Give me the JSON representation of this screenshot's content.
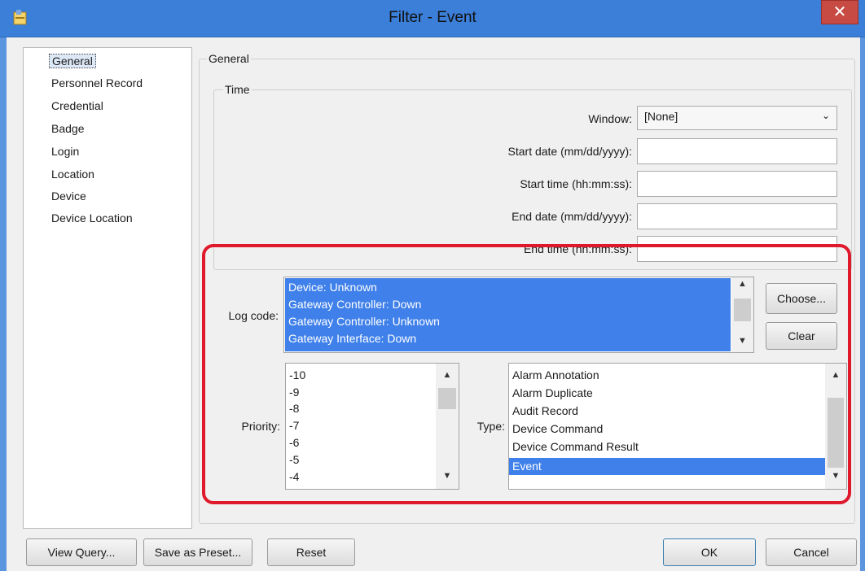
{
  "window": {
    "title": "Filter - Event",
    "close_glyph": "✕"
  },
  "nav": {
    "items": [
      "General",
      "Personnel Record",
      "Credential",
      "Badge",
      "Login",
      "Location",
      "Device",
      "Device Location"
    ],
    "selected_index": 0
  },
  "general": {
    "group_label": "General",
    "time_group_label": "Time",
    "window_label": "Window:",
    "window_value": "[None]",
    "start_date_label": "Start date (mm/dd/yyyy):",
    "start_time_label": "Start time (hh:mm:ss):",
    "end_date_label": "End date (mm/dd/yyyy):",
    "end_time_label": "End time (hh:mm:ss):",
    "start_date_value": "",
    "start_time_value": "",
    "end_date_value": "",
    "end_time_value": ""
  },
  "log_code": {
    "label": "Log code:",
    "items": [
      "Device: Unknown",
      "Gateway Controller: Down",
      "Gateway Controller: Unknown",
      "Gateway Interface: Down"
    ],
    "choose_label": "Choose...",
    "clear_label": "Clear"
  },
  "priority": {
    "label": "Priority:",
    "items": [
      "-10",
      "-9",
      "-8",
      "-7",
      "-6",
      "-5",
      "-4"
    ]
  },
  "type": {
    "label": "Type:",
    "items": [
      "Alarm Annotation",
      "Alarm Duplicate",
      "Audit Record",
      "Device Command",
      "Device Command Result",
      "Event"
    ],
    "selected": "Event"
  },
  "footer": {
    "view_query": "View Query...",
    "save_preset": "Save as Preset...",
    "reset": "Reset",
    "ok": "OK",
    "cancel": "Cancel"
  },
  "colors": {
    "titlebar": "#3b7fd9",
    "selection": "#3f80ea",
    "highlight_outline": "#e0182b",
    "close_button": "#c74b42"
  },
  "icons": [
    "app-icon",
    "close-icon",
    "chevron-down-icon",
    "scroll-up-icon",
    "scroll-down-icon"
  ]
}
